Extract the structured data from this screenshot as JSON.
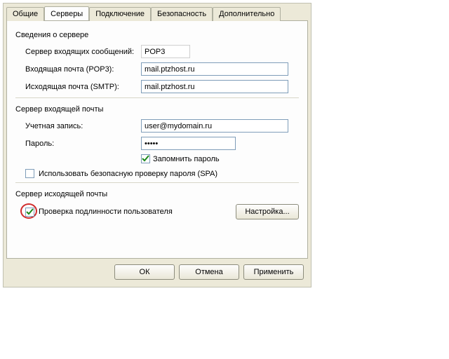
{
  "tabs": {
    "general": "Общие",
    "servers": "Серверы",
    "connection": "Подключение",
    "security": "Безопасность",
    "advanced": "Дополнительно"
  },
  "serverInfo": {
    "groupLabel": "Сведения о сервере",
    "incomingTypeLabel": "Сервер входящих сообщений:",
    "incomingType": "POP3",
    "incomingPopLabel": "Входящая почта (POP3):",
    "incomingPop": "mail.ptzhost.ru",
    "outgoingSmtpLabel": "Исходящая почта (SMTP):",
    "outgoingSmtp": "mail.ptzhost.ru"
  },
  "incomingServer": {
    "groupLabel": "Сервер входящей почты",
    "accountLabel": "Учетная запись:",
    "account": "user@mydomain.ru",
    "passwordLabel": "Пароль:",
    "password": "•••••",
    "remember": "Запомнить пароль",
    "spa": "Использовать безопасную проверку пароля (SPA)"
  },
  "outgoingServer": {
    "groupLabel": "Сервер исходящей почты",
    "auth": "Проверка подлинности пользователя",
    "settings": "Настройка..."
  },
  "buttons": {
    "ok": "ОК",
    "cancel": "Отмена",
    "apply": "Применить"
  }
}
